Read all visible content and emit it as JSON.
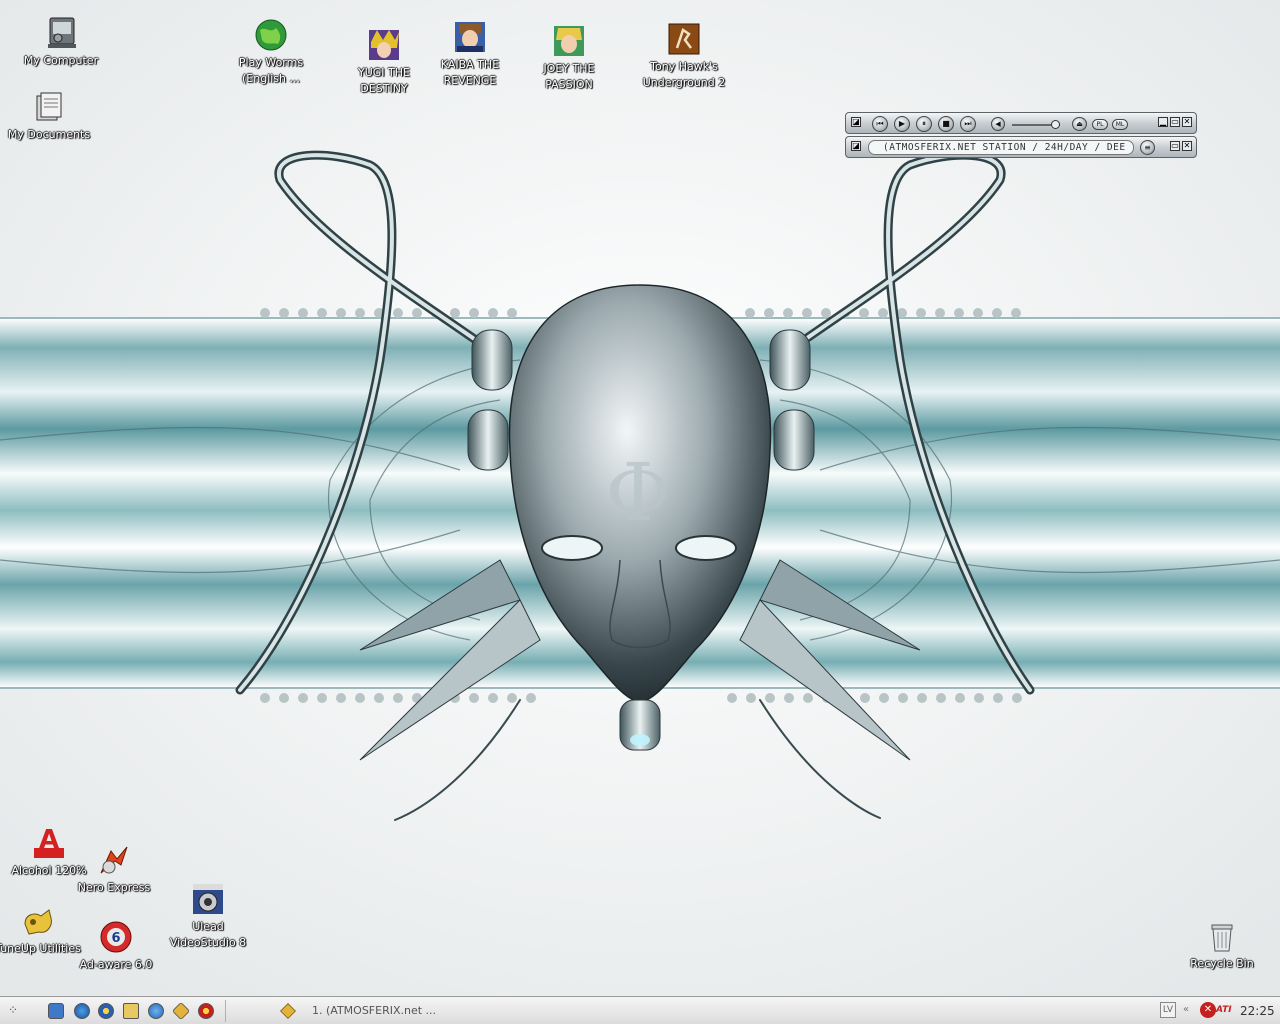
{
  "desktop": {
    "icons": [
      {
        "id": "my-computer",
        "label": "My Computer"
      },
      {
        "id": "my-documents",
        "label": "My Documents"
      },
      {
        "id": "play-worms",
        "label": "Play Worms (English ..."
      },
      {
        "id": "yugi",
        "label": "YUGI THE DESTINY"
      },
      {
        "id": "kaiba",
        "label": "KAIBA THE REVENGE"
      },
      {
        "id": "joey",
        "label": "JOEY THE PASSION"
      },
      {
        "id": "tony-hawk",
        "label": "Tony Hawk's Underground 2"
      },
      {
        "id": "alcohol",
        "label": "Alcohol 120%"
      },
      {
        "id": "nero",
        "label": "Nero Express"
      },
      {
        "id": "ulead",
        "label": "Ulead VideoStudio 8"
      },
      {
        "id": "tuneup",
        "label": "TuneUp Utilities"
      },
      {
        "id": "adaware",
        "label": "Ad-aware 6.0"
      },
      {
        "id": "recycle",
        "label": "Recycle Bin"
      }
    ],
    "wallpaper_symbol": "Φ"
  },
  "winamp": {
    "main_buttons": [
      "prev",
      "play",
      "pause",
      "stop",
      "next"
    ],
    "pills": [
      "PL",
      "ML"
    ],
    "display_text": "(ATMOSFERIX.NET  STATION  / 24H/DAY / DEE"
  },
  "taskbar": {
    "task_label": "1. (ATMOSFERIX.net  ...",
    "tray_text": "LV",
    "tray_ati": "ATI",
    "clock": "22:25"
  },
  "colors": {
    "accent": "#6fa7ad",
    "taskbar": "#dcdcdc"
  }
}
